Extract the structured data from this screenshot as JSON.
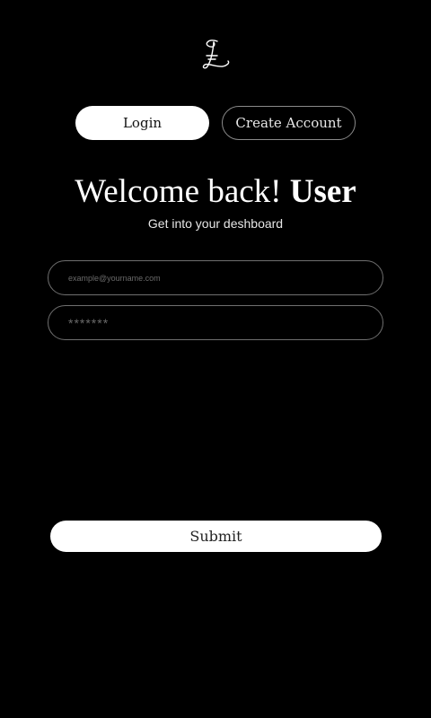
{
  "logo": {
    "icon": "script-L-monogram-icon"
  },
  "tabs": {
    "login_label": "Login",
    "create_label": "Create Account"
  },
  "heading": {
    "prefix": "Welcome back!",
    "name": "User"
  },
  "subheading": "Get into your deshboard",
  "form": {
    "email_placeholder": "example@yourname.com",
    "email_value": "",
    "password_placeholder": "*******",
    "password_value": "",
    "submit_label": "Submit"
  },
  "colors": {
    "background": "#000000",
    "primary": "#ffffff",
    "border": "#6f6f6f"
  }
}
